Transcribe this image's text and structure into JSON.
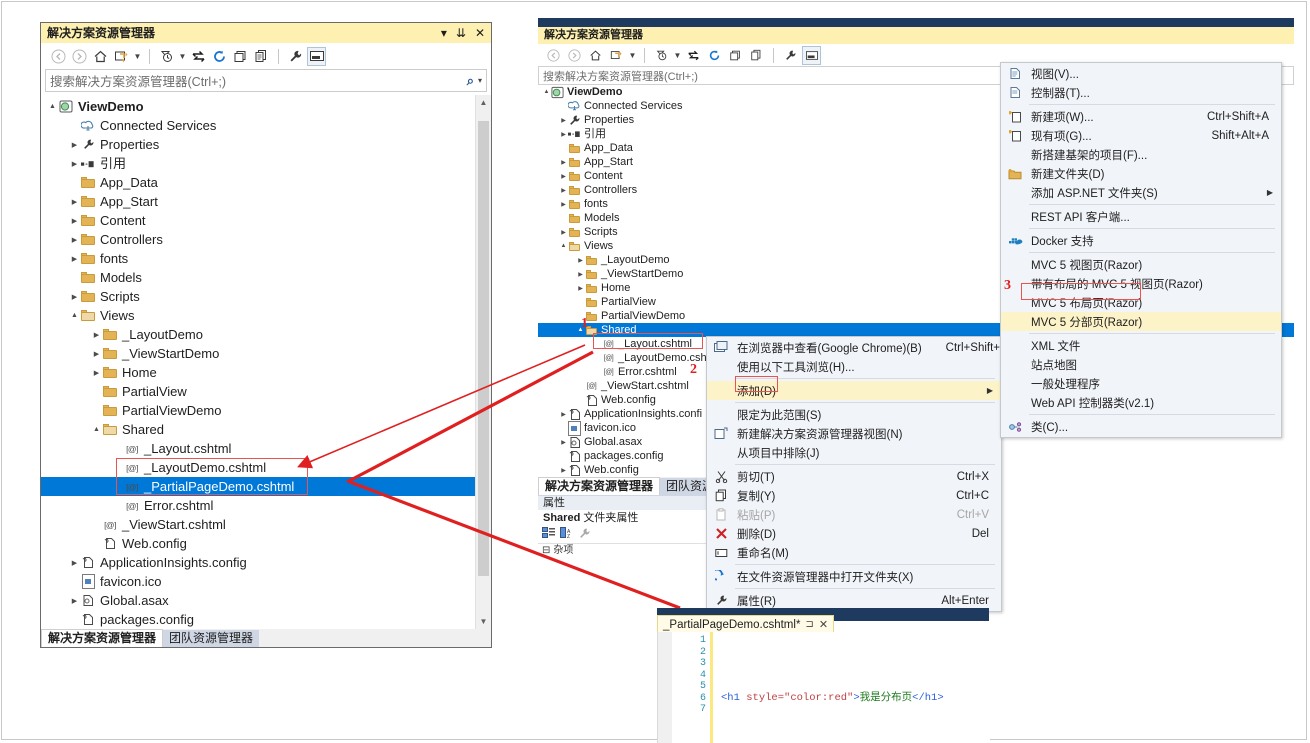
{
  "left_window": {
    "title": "解决方案资源管理器",
    "title_buttons": [
      "▾",
      "⏷",
      "✕"
    ],
    "toolbar_icons": [
      "back-arrow-icon",
      "forward-arrow-icon",
      "home-icon",
      "sync-with-active-document-icon",
      "dropdown-caret-icon",
      "pending-changes-filter-icon",
      "dropdown-caret-icon",
      "refresh-swap-icon",
      "refresh-icon",
      "collapse-all-icon",
      "show-all-files-icon",
      "properties-wrench-icon",
      "preview-selected-items-icon"
    ],
    "search_placeholder": "搜索解决方案资源管理器(Ctrl+;)",
    "tree": [
      {
        "depth": 0,
        "exp": "▲",
        "icon": "solution-icon",
        "label": "ViewDemo",
        "bold": true
      },
      {
        "depth": 1,
        "exp": "",
        "icon": "connected-services-icon",
        "label": "Connected Services"
      },
      {
        "depth": 1,
        "exp": "▶",
        "icon": "wrench-icon",
        "label": "Properties"
      },
      {
        "depth": 1,
        "exp": "▶",
        "icon": "references-icon",
        "label": "引用"
      },
      {
        "depth": 1,
        "exp": "",
        "icon": "folder-icon",
        "label": "App_Data"
      },
      {
        "depth": 1,
        "exp": "▶",
        "icon": "folder-icon",
        "label": "App_Start"
      },
      {
        "depth": 1,
        "exp": "▶",
        "icon": "folder-icon",
        "label": "Content"
      },
      {
        "depth": 1,
        "exp": "▶",
        "icon": "folder-icon",
        "label": "Controllers"
      },
      {
        "depth": 1,
        "exp": "▶",
        "icon": "folder-icon",
        "label": "fonts"
      },
      {
        "depth": 1,
        "exp": "",
        "icon": "folder-icon",
        "label": "Models"
      },
      {
        "depth": 1,
        "exp": "▶",
        "icon": "folder-icon",
        "label": "Scripts"
      },
      {
        "depth": 1,
        "exp": "▲",
        "icon": "folder-open-icon",
        "label": "Views"
      },
      {
        "depth": 2,
        "exp": "▶",
        "icon": "folder-icon",
        "label": "_LayoutDemo"
      },
      {
        "depth": 2,
        "exp": "▶",
        "icon": "folder-icon",
        "label": "_ViewStartDemo"
      },
      {
        "depth": 2,
        "exp": "▶",
        "icon": "folder-icon",
        "label": "Home"
      },
      {
        "depth": 2,
        "exp": "",
        "icon": "folder-icon",
        "label": "PartialView"
      },
      {
        "depth": 2,
        "exp": "",
        "icon": "folder-icon",
        "label": "PartialViewDemo"
      },
      {
        "depth": 2,
        "exp": "▲",
        "icon": "folder-open-icon",
        "label": "Shared"
      },
      {
        "depth": 3,
        "exp": "",
        "icon": "razor-icon",
        "label": "_Layout.cshtml"
      },
      {
        "depth": 3,
        "exp": "",
        "icon": "razor-icon",
        "label": "_LayoutDemo.cshtml"
      },
      {
        "depth": 3,
        "exp": "",
        "icon": "razor-icon",
        "label": "_PartialPageDemo.cshtml",
        "selected": true
      },
      {
        "depth": 3,
        "exp": "",
        "icon": "razor-icon",
        "label": "Error.cshtml"
      },
      {
        "depth": 2,
        "exp": "",
        "icon": "razor-icon",
        "label": "_ViewStart.cshtml"
      },
      {
        "depth": 2,
        "exp": "",
        "icon": "config-icon",
        "label": "Web.config"
      },
      {
        "depth": 1,
        "exp": "▶",
        "icon": "config-icon",
        "label": "ApplicationInsights.config"
      },
      {
        "depth": 1,
        "exp": "",
        "icon": "ico-file-icon",
        "label": "favicon.ico"
      },
      {
        "depth": 1,
        "exp": "▶",
        "icon": "asax-icon",
        "label": "Global.asax"
      },
      {
        "depth": 1,
        "exp": "",
        "icon": "config-icon",
        "label": "packages.config"
      }
    ],
    "tabs": [
      {
        "label": "解决方案资源管理器",
        "active": true
      },
      {
        "label": "团队资源管理器",
        "active": false
      }
    ]
  },
  "right_window": {
    "title": "解决方案资源管理器",
    "search_placeholder": "搜索解决方案资源管理器(Ctrl+;)",
    "tree": [
      {
        "depth": 0,
        "exp": "▲",
        "icon": "solution-icon",
        "label": "ViewDemo",
        "bold": true
      },
      {
        "depth": 1,
        "exp": "",
        "icon": "connected-services-icon",
        "label": "Connected Services"
      },
      {
        "depth": 1,
        "exp": "▶",
        "icon": "wrench-icon",
        "label": "Properties"
      },
      {
        "depth": 1,
        "exp": "▶",
        "icon": "references-icon",
        "label": "引用"
      },
      {
        "depth": 1,
        "exp": "",
        "icon": "folder-icon",
        "label": "App_Data"
      },
      {
        "depth": 1,
        "exp": "▶",
        "icon": "folder-icon",
        "label": "App_Start"
      },
      {
        "depth": 1,
        "exp": "▶",
        "icon": "folder-icon",
        "label": "Content"
      },
      {
        "depth": 1,
        "exp": "▶",
        "icon": "folder-icon",
        "label": "Controllers"
      },
      {
        "depth": 1,
        "exp": "▶",
        "icon": "folder-icon",
        "label": "fonts"
      },
      {
        "depth": 1,
        "exp": "",
        "icon": "folder-icon",
        "label": "Models"
      },
      {
        "depth": 1,
        "exp": "▶",
        "icon": "folder-icon",
        "label": "Scripts"
      },
      {
        "depth": 1,
        "exp": "▲",
        "icon": "folder-open-icon",
        "label": "Views"
      },
      {
        "depth": 2,
        "exp": "▶",
        "icon": "folder-icon",
        "label": "_LayoutDemo"
      },
      {
        "depth": 2,
        "exp": "▶",
        "icon": "folder-icon",
        "label": "_ViewStartDemo"
      },
      {
        "depth": 2,
        "exp": "▶",
        "icon": "folder-icon",
        "label": "Home"
      },
      {
        "depth": 2,
        "exp": "",
        "icon": "folder-icon",
        "label": "PartialView"
      },
      {
        "depth": 2,
        "exp": "",
        "icon": "folder-icon",
        "label": "PartialViewDemo"
      },
      {
        "depth": 2,
        "exp": "▲",
        "icon": "folder-open-icon",
        "label": "Shared",
        "selected": true
      },
      {
        "depth": 3,
        "exp": "",
        "icon": "razor-icon",
        "label": "_Layout.cshtml"
      },
      {
        "depth": 3,
        "exp": "",
        "icon": "razor-icon",
        "label": "_LayoutDemo.csht"
      },
      {
        "depth": 3,
        "exp": "",
        "icon": "razor-icon",
        "label": "Error.cshtml"
      },
      {
        "depth": 2,
        "exp": "",
        "icon": "razor-icon",
        "label": "_ViewStart.cshtml"
      },
      {
        "depth": 2,
        "exp": "",
        "icon": "config-icon",
        "label": "Web.config"
      },
      {
        "depth": 1,
        "exp": "▶",
        "icon": "config-icon",
        "label": "ApplicationInsights.confi"
      },
      {
        "depth": 1,
        "exp": "",
        "icon": "ico-file-icon",
        "label": "favicon.ico"
      },
      {
        "depth": 1,
        "exp": "▶",
        "icon": "asax-icon",
        "label": "Global.asax"
      },
      {
        "depth": 1,
        "exp": "",
        "icon": "config-icon",
        "label": "packages.config"
      },
      {
        "depth": 1,
        "exp": "▶",
        "icon": "config-icon",
        "label": "Web.config"
      }
    ],
    "tabs": [
      {
        "label": "解决方案资源管理器",
        "active": true
      },
      {
        "label": "团队资源管理器",
        "active": false
      }
    ],
    "properties": {
      "header": "属性",
      "target_name": "Shared",
      "target_kind": "文件夹属性",
      "first_row": "杂项"
    }
  },
  "context_menu_add": {
    "items": [
      {
        "label": "在浏览器中查看(Google Chrome)(B)",
        "accel": "Ctrl+Shift+W",
        "icon": "browser-icon"
      },
      {
        "label": "使用以下工具浏览(H)...",
        "accel": "",
        "icon": ""
      },
      {
        "sep": true
      },
      {
        "label": "添加(D)",
        "accel": "",
        "icon": "",
        "submenu": true,
        "highlighted": true,
        "boxed": true
      },
      {
        "sep": true
      },
      {
        "label": "限定为此范围(S)",
        "accel": "",
        "icon": ""
      },
      {
        "label": "新建解决方案资源管理器视图(N)",
        "accel": "",
        "icon": "new-solution-view-icon"
      },
      {
        "label": "从项目中排除(J)",
        "accel": "",
        "icon": ""
      },
      {
        "sep": true
      },
      {
        "label": "剪切(T)",
        "accel": "Ctrl+X",
        "icon": "scissors-icon"
      },
      {
        "label": "复制(Y)",
        "accel": "Ctrl+C",
        "icon": "copy-icon"
      },
      {
        "label": "粘贴(P)",
        "accel": "Ctrl+V",
        "icon": "paste-icon",
        "disabled": true
      },
      {
        "label": "删除(D)",
        "accel": "Del",
        "icon": "delete-x-icon"
      },
      {
        "label": "重命名(M)",
        "accel": "",
        "icon": "rename-icon"
      },
      {
        "sep": true
      },
      {
        "label": "在文件资源管理器中打开文件夹(X)",
        "accel": "",
        "icon": "open-folder-arrow-icon"
      },
      {
        "sep": true
      },
      {
        "label": "属性(R)",
        "accel": "Alt+Enter",
        "icon": "wrench-icon"
      }
    ]
  },
  "context_menu_submenu": {
    "items": [
      {
        "label": "视图(V)...",
        "accel": "",
        "icon": "view-page-icon"
      },
      {
        "label": "控制器(T)...",
        "accel": "",
        "icon": "controller-page-icon"
      },
      {
        "sep": true
      },
      {
        "label": "新建项(W)...",
        "accel": "Ctrl+Shift+A",
        "icon": "new-item-icon"
      },
      {
        "label": "现有项(G)...",
        "accel": "Shift+Alt+A",
        "icon": "existing-item-icon"
      },
      {
        "label": "新搭建基架的项目(F)...",
        "accel": "",
        "icon": ""
      },
      {
        "label": "新建文件夹(D)",
        "accel": "",
        "icon": "new-folder-icon"
      },
      {
        "label": "添加 ASP.NET 文件夹(S)",
        "accel": "",
        "icon": "",
        "submenu": true
      },
      {
        "sep": true
      },
      {
        "label": "REST API 客户端...",
        "accel": "",
        "icon": ""
      },
      {
        "sep": true
      },
      {
        "label": "Docker 支持",
        "accel": "",
        "icon": "docker-icon"
      },
      {
        "sep": true
      },
      {
        "label": "MVC 5 视图页(Razor)",
        "accel": "",
        "icon": ""
      },
      {
        "label": "带有布局的 MVC 5 视图页(Razor)",
        "accel": "",
        "icon": ""
      },
      {
        "label": "MVC 5 布局页(Razor)",
        "accel": "",
        "icon": ""
      },
      {
        "label": "MVC 5 分部页(Razor)",
        "accel": "",
        "icon": "",
        "highlighted": true,
        "boxed": true
      },
      {
        "sep": true
      },
      {
        "label": "XML 文件",
        "accel": "",
        "icon": ""
      },
      {
        "label": "站点地图",
        "accel": "",
        "icon": ""
      },
      {
        "label": "一般处理程序",
        "accel": "",
        "icon": ""
      },
      {
        "label": "Web API 控制器类(v2.1)",
        "accel": "",
        "icon": ""
      },
      {
        "sep": true
      },
      {
        "label": "类(C)...",
        "accel": "",
        "icon": "class-icon"
      }
    ]
  },
  "annotations": {
    "step1": "1",
    "step2": "2",
    "step3": "3",
    "accent_red": "#e02020",
    "box_red": "#e8544f"
  },
  "editor": {
    "tab_label": "_PartialPageDemo.cshtml*",
    "tab_pin": "⊐",
    "tab_close": "✕",
    "line_numbers": [
      "1",
      "2",
      "3",
      "4",
      "5",
      "6",
      "7"
    ],
    "code": {
      "open_tag": "<h1 ",
      "attr_name": "style=",
      "attr_value": "\"color:red\"",
      "gt": ">",
      "text": "我是分布页",
      "close_tag": "</h1>"
    }
  }
}
